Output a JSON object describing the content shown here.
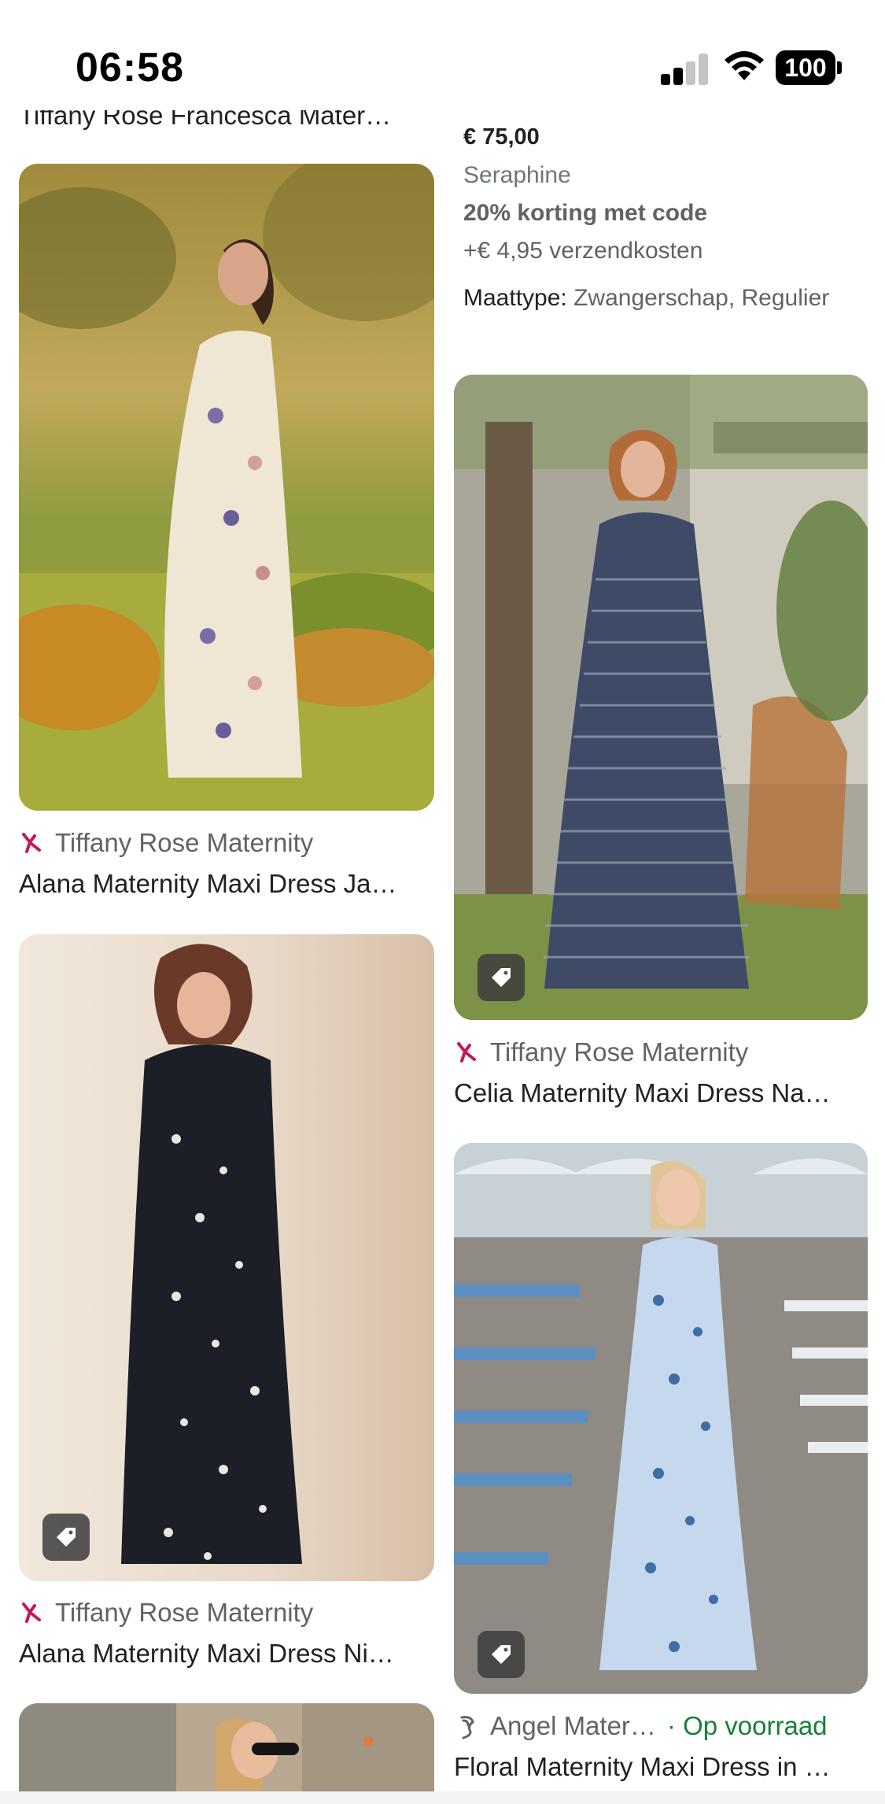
{
  "status_bar": {
    "time": "06:58",
    "battery": "100"
  },
  "cut_off_title": "Tiffany Rose Francesca Mater…",
  "offer": {
    "price": "€ 75,00",
    "merchant": "Seraphine",
    "promo": "20% korting met code",
    "shipping": "+€ 4,95 verzendkosten",
    "size_type_label": "Maattype:",
    "size_type_value": "Zwangerschap, Regulier"
  },
  "cards": [
    {
      "source": "Tiffany Rose Maternity",
      "title": "Alana Maternity Maxi Dress Ja…",
      "image": "cream-floral-maxi-dress-garden"
    },
    {
      "source": "Tiffany Rose Maternity",
      "title": "Celia Maternity Maxi Dress Na…",
      "image": "navy-striped-maxi-dress"
    },
    {
      "source": "Tiffany Rose Maternity",
      "title": "Alana Maternity Maxi Dress Ni…",
      "image": "black-floral-maxi-dress"
    },
    {
      "source": "Angel Mater…",
      "stock": "· Op voorraad",
      "title": "Floral Maternity Maxi Dress in …",
      "image": "blue-floral-maxi-dress-beach"
    },
    {
      "image": "woman-sunglasses-coast"
    }
  ],
  "colors": {
    "in_stock": "#188038",
    "tiffany_icon": "#c2185b"
  }
}
